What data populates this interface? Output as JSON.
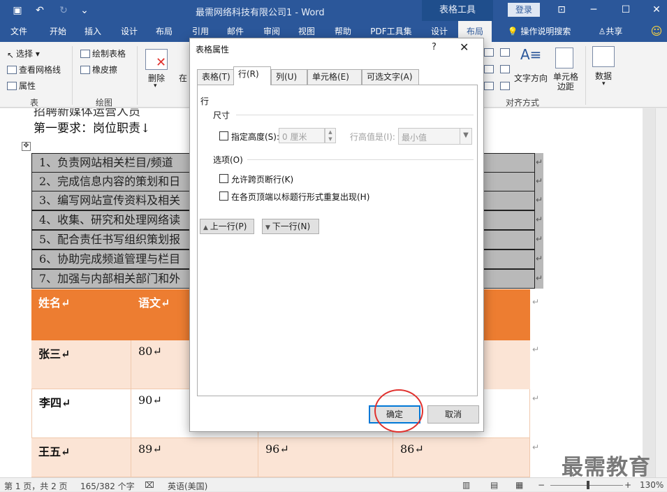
{
  "titlebar": {
    "doc_title": "最需网络科技有限公司1  -  Word",
    "context_tab": "表格工具",
    "login": "登录"
  },
  "ribbon_tabs": [
    "文件",
    "开始",
    "插入",
    "设计",
    "布局",
    "引用",
    "邮件",
    "审阅",
    "视图",
    "帮助",
    "PDF工具集",
    "设计",
    "布局"
  ],
  "ribbon_tabs_active_index": 12,
  "tell_me": "操作说明搜索",
  "share": "共享",
  "ribbon": {
    "select": "选择",
    "view_gridlines": "查看网格线",
    "properties": "属性",
    "group_table": "表",
    "draw_table": "绘制表格",
    "eraser": "橡皮擦",
    "group_draw": "绘图",
    "delete": "删除",
    "insert_partial": "在",
    "text_direction": "文字方向",
    "cell_margins": "单元格边距",
    "group_align": "对齐方式",
    "data": "数据"
  },
  "document": {
    "line_partial": "招聘新媒体运营人员",
    "line_first_req": "第一要求：岗位职责↓",
    "requirements": [
      "1、负责网站相关栏目/频道",
      "2、完成信息内容的策划和日",
      "3、编写网站宣传资料及相关",
      "4、收集、研究和处理网络读",
      "5、配合责任书写组织策划报",
      "6、协助完成频道管理与栏目",
      "7、加强与内部相关部门和外"
    ],
    "score_headers": [
      "姓名↵",
      "语文↵"
    ],
    "score_rows": [
      {
        "name": "张三↵",
        "cells": [
          "80↵",
          "",
          ""
        ]
      },
      {
        "name": "李四↵",
        "cells": [
          "90↵",
          "",
          ""
        ]
      },
      {
        "name": "王五↵",
        "cells": [
          "89↵",
          "96↵",
          "86↵"
        ]
      }
    ]
  },
  "dialog": {
    "title": "表格属性",
    "help": "?",
    "close": "✕",
    "tabs": [
      "表格(T)",
      "行(R)",
      "列(U)",
      "单元格(E)",
      "可选文字(A)"
    ],
    "active_tab": 1,
    "section_row": "行",
    "size_label": "尺寸",
    "specify_height": "指定高度(S):",
    "height_value": "0 厘米",
    "row_height_is": "行高值是(I):",
    "row_height_mode": "最小值",
    "options_label": "选项(O)",
    "allow_break": "允许跨页断行(K)",
    "repeat_header": "在各页顶端以标题行形式重复出现(H)",
    "prev_row": "上一行(P)",
    "next_row": "下一行(N)",
    "ok": "确定",
    "cancel": "取消"
  },
  "statusbar": {
    "page": "第 1 页，共 2 页",
    "words": "165/382 个字",
    "language": "英语(美国)",
    "zoom": "130%"
  },
  "watermark": "最需教育",
  "colors": {
    "accent": "#2b579a",
    "table_header": "#ed7d31",
    "table_band": "#fbe4d5",
    "annotation_circle": "#e0312d"
  }
}
